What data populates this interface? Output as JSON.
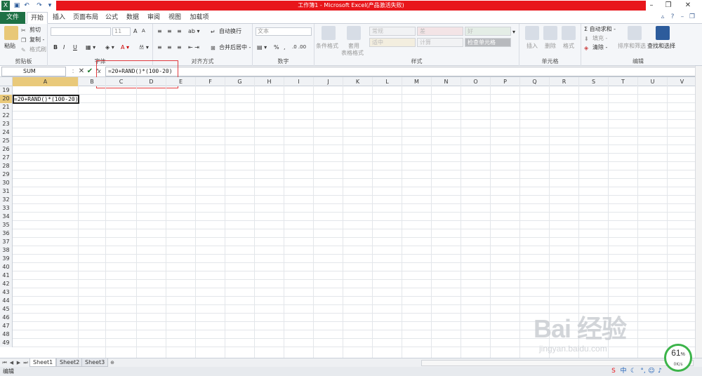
{
  "title_bar": {
    "title": "工作簿1 - Microsoft Excel(产品激活失败)",
    "qa_icons": [
      "excel-icon",
      "save-icon",
      "undo-icon",
      "redo-icon",
      "customize-icon"
    ],
    "window_controls": [
      "help-icon",
      "minimize-icon",
      "restore-icon",
      "close-icon"
    ]
  },
  "tabs": [
    "文件",
    "开始",
    "插入",
    "页面布局",
    "公式",
    "数据",
    "审阅",
    "视图",
    "加载项"
  ],
  "ribbon": {
    "clipboard": {
      "label": "剪贴板",
      "paste": "粘贴",
      "cut": "剪切",
      "copy": "复制 -",
      "format_painter": "格式刷"
    },
    "font": {
      "label": "字体",
      "size": "11",
      "bold": "B",
      "italic": "I",
      "underline": "U",
      "grow": "A",
      "shrink": "A"
    },
    "alignment": {
      "label": "对齐方式",
      "wrap": "自动换行",
      "merge": "合并后居中 -"
    },
    "number": {
      "label": "数字",
      "format": "文本",
      "percent": "%",
      "comma": ","
    },
    "styles": {
      "label": "样式",
      "conditional": "条件格式",
      "table": "套用",
      "table2": "表格格式",
      "cells": [
        "常规",
        "差",
        "好",
        "适中",
        "计算",
        "检查单元格"
      ]
    },
    "cells_group": {
      "label": "单元格",
      "insert": "插入",
      "delete": "删除",
      "format": "格式"
    },
    "editing": {
      "label": "编辑",
      "autosum": "Σ 自动求和 -",
      "fill": "填充 -",
      "clear": "清除 -",
      "sort": "排序和筛选",
      "find": "查找和选择"
    }
  },
  "formula_bar": {
    "name_box": "SUM",
    "cancel": "✕",
    "enter": "✔",
    "fx": "fx",
    "formula": "=20+RAND()*(100-20)"
  },
  "columns": [
    "A",
    "B",
    "C",
    "D",
    "E",
    "F",
    "G",
    "H",
    "I",
    "J",
    "K",
    "L",
    "M",
    "N",
    "O",
    "P",
    "Q",
    "R",
    "S",
    "T",
    "U",
    "V"
  ],
  "rows": [
    "19",
    "20",
    "21",
    "22",
    "23",
    "24",
    "25",
    "26",
    "27",
    "28",
    "29",
    "30",
    "31",
    "32",
    "33",
    "34",
    "35",
    "36",
    "37",
    "38",
    "39",
    "40",
    "41",
    "42",
    "43",
    "44",
    "45",
    "46",
    "47",
    "48",
    "49"
  ],
  "active_cell": {
    "value": "=20+RAND()*(100-20)"
  },
  "sheets": [
    "Sheet1",
    "Sheet2",
    "Sheet3"
  ],
  "status": {
    "mode": "编辑"
  },
  "tray": {
    "ime": "中"
  },
  "speed_widget": {
    "percent": "61",
    "unit": "%",
    "rate": "0K/s"
  },
  "watermark": {
    "brand": "Bai 经验",
    "url": "jingyan.baidu.com"
  },
  "colors": {
    "file_tab": "#1e7145",
    "title_red": "#e8161b",
    "selected_header": "#e9c97a",
    "highlight_box": "#e0393d"
  }
}
